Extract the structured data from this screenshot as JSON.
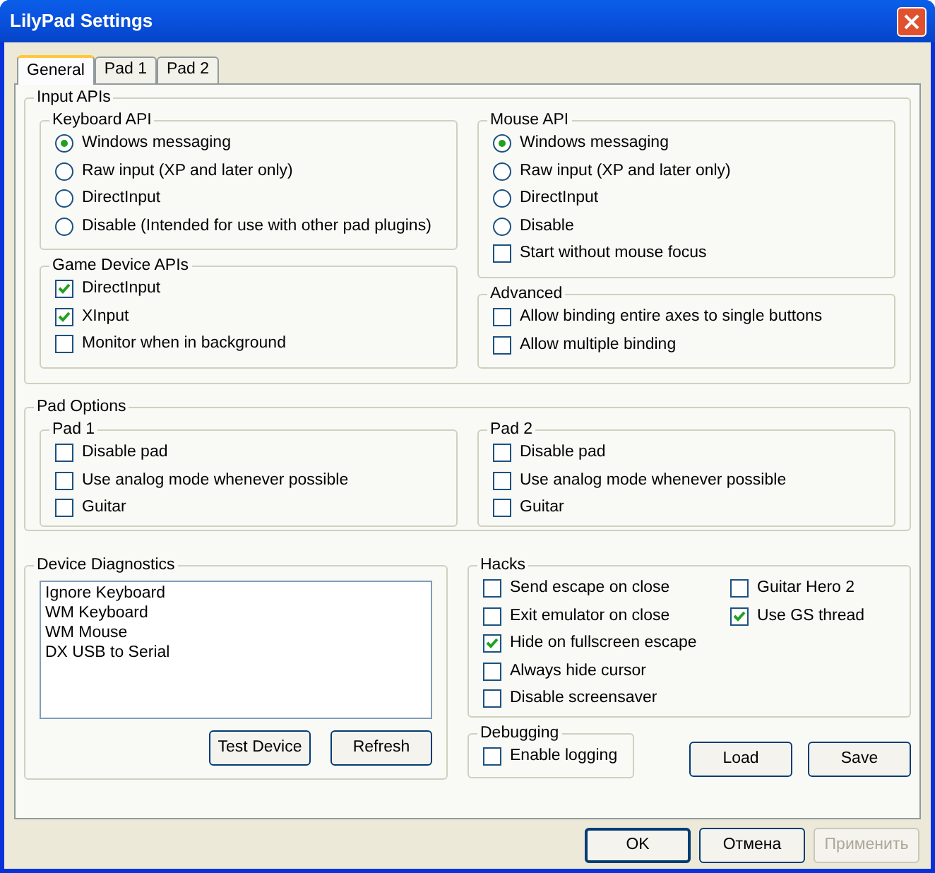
{
  "window": {
    "title": "LilyPad Settings"
  },
  "tabs": [
    {
      "label": "General",
      "selected": true
    },
    {
      "label": "Pad 1",
      "selected": false
    },
    {
      "label": "Pad 2",
      "selected": false
    }
  ],
  "input_apis": {
    "title": "Input APIs",
    "left": [
      {
        "title": "Keyboard API",
        "items": [
          {
            "kind": "radio",
            "label": "Windows messaging",
            "selected": true
          },
          {
            "kind": "radio",
            "label": "Raw input (XP and later only)",
            "selected": false
          },
          {
            "kind": "radio",
            "label": "DirectInput",
            "selected": false
          },
          {
            "kind": "radio",
            "label": "Disable (Intended for use with other pad plugins)",
            "selected": false
          }
        ]
      },
      {
        "title": "Game Device APIs",
        "items": [
          {
            "kind": "checkbox",
            "label": "DirectInput",
            "checked": true
          },
          {
            "kind": "checkbox",
            "label": "XInput",
            "checked": true
          },
          {
            "kind": "checkbox",
            "label": "Monitor when in background",
            "checked": false
          }
        ]
      }
    ],
    "right": [
      {
        "title": "Mouse API",
        "items": [
          {
            "kind": "radio",
            "label": "Windows messaging",
            "selected": true
          },
          {
            "kind": "radio",
            "label": "Raw input (XP and later only)",
            "selected": false
          },
          {
            "kind": "radio",
            "label": "DirectInput",
            "selected": false
          },
          {
            "kind": "radio",
            "label": "Disable",
            "selected": false
          },
          {
            "kind": "checkbox",
            "label": "Start without mouse focus",
            "checked": false
          }
        ]
      },
      {
        "title": "Advanced",
        "items": [
          {
            "kind": "checkbox",
            "label": "Allow binding entire axes to single buttons",
            "checked": false
          },
          {
            "kind": "checkbox",
            "label": "Allow multiple binding",
            "checked": false
          }
        ]
      }
    ]
  },
  "pad_options": {
    "title": "Pad Options",
    "pads": [
      {
        "title": "Pad 1",
        "items": [
          {
            "kind": "checkbox",
            "label": "Disable pad",
            "checked": false
          },
          {
            "kind": "checkbox",
            "label": "Use analog mode whenever possible",
            "checked": false
          },
          {
            "kind": "checkbox",
            "label": "Guitar",
            "checked": false
          }
        ]
      },
      {
        "title": "Pad 2",
        "items": [
          {
            "kind": "checkbox",
            "label": "Disable pad",
            "checked": false
          },
          {
            "kind": "checkbox",
            "label": "Use analog mode whenever possible",
            "checked": false
          },
          {
            "kind": "checkbox",
            "label": "Guitar",
            "checked": false
          }
        ]
      }
    ]
  },
  "device_diagnostics": {
    "title": "Device Diagnostics",
    "devices": [
      "Ignore Keyboard",
      "WM Keyboard",
      "WM Mouse",
      "DX USB to Serial"
    ],
    "buttons": [
      "Test Device",
      "Refresh"
    ]
  },
  "hacks": {
    "title": "Hacks",
    "columns": [
      [
        {
          "kind": "checkbox",
          "label": "Send escape on close",
          "checked": false
        },
        {
          "kind": "checkbox",
          "label": "Exit emulator on close",
          "checked": false
        },
        {
          "kind": "checkbox",
          "label": "Hide on fullscreen escape",
          "checked": true
        },
        {
          "kind": "checkbox",
          "label": "Always hide cursor",
          "checked": false
        },
        {
          "kind": "checkbox",
          "label": "Disable screensaver",
          "checked": false
        }
      ],
      [
        {
          "kind": "checkbox",
          "label": "Guitar Hero 2",
          "checked": false
        },
        {
          "kind": "checkbox",
          "label": "Use GS thread",
          "checked": true
        }
      ]
    ]
  },
  "debugging": {
    "title": "Debugging",
    "items": [
      {
        "kind": "checkbox",
        "label": "Enable logging",
        "checked": false
      }
    ]
  },
  "file_buttons": [
    "Load",
    "Save"
  ],
  "dialog_buttons": [
    {
      "label": "OK",
      "default": true,
      "disabled": false
    },
    {
      "label": "Отмена",
      "default": false,
      "disabled": false
    },
    {
      "label": "Применить",
      "default": false,
      "disabled": true
    }
  ]
}
